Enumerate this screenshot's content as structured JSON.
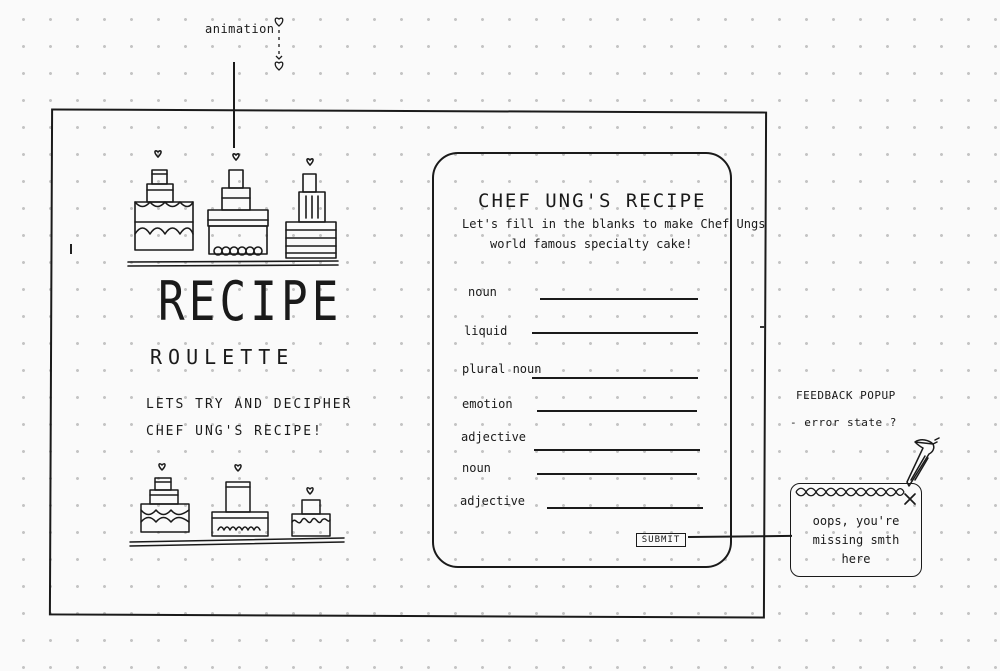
{
  "annotations": {
    "animation": "animation",
    "feedback_title": "FEEDBACK POPUP",
    "feedback_sub": "- error state ?"
  },
  "landing": {
    "title": "RECIPE",
    "subtitle": "ROULETTE",
    "tagline_1": "LETS TRY AND DECIPHER",
    "tagline_2": "CHEF UNG'S RECIPE!"
  },
  "form": {
    "title": "CHEF UNG'S RECIPE",
    "intro_1": "Let's fill in the blanks to make Chef Ungs",
    "intro_2": "world famous specialty cake!",
    "fields": [
      {
        "label": "noun"
      },
      {
        "label": "liquid"
      },
      {
        "label": "plural noun"
      },
      {
        "label": "emotion"
      },
      {
        "label": "adjective"
      },
      {
        "label": "noun"
      },
      {
        "label": "adjective"
      }
    ],
    "submit_label": "SUBMIT"
  },
  "popup": {
    "line_1": "oops, you're",
    "line_2": "missing smth",
    "line_3": "here",
    "close_glyph": "×"
  },
  "icons": {
    "heart": "heart-icon",
    "cake": "cake-icon",
    "close": "close-icon",
    "piping_bag": "piping-bag-icon"
  },
  "colors": {
    "ink": "#1a1a1a",
    "paper": "#fafafa",
    "dot": "#c4c4c4"
  }
}
